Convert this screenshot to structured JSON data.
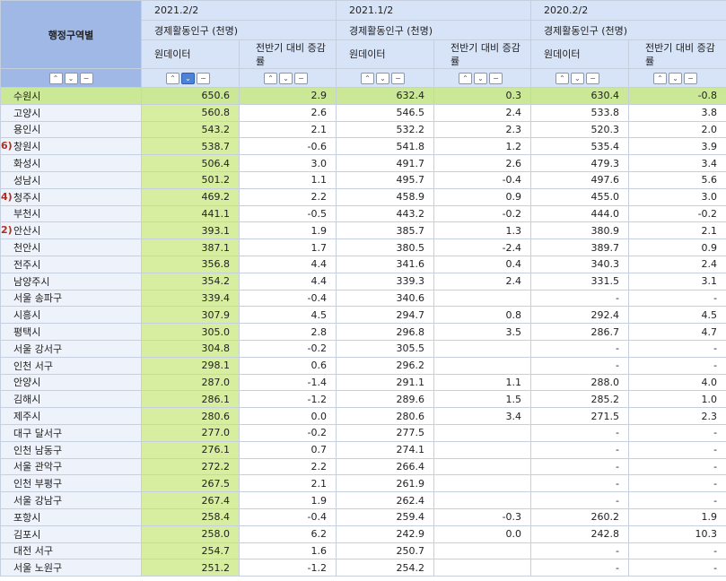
{
  "header": {
    "region_label": "행정구역별",
    "periods": [
      "2021.2/2",
      "2021.1/2",
      "2020.2/2"
    ],
    "indicator": "경제활동인구 (천명)",
    "col_raw": "원데이터",
    "col_rate": "전반기 대비 증감률"
  },
  "controls": {
    "up": "⌃",
    "down": "⌄",
    "minus": "−"
  },
  "rows": [
    {
      "name": "수원시",
      "a1": "650.6",
      "r1": "2.9",
      "a2": "632.4",
      "r2": "0.3",
      "a3": "630.4",
      "r3": "-0.8",
      "marker": ""
    },
    {
      "name": "고양시",
      "a1": "560.8",
      "r1": "2.6",
      "a2": "546.5",
      "r2": "2.4",
      "a3": "533.8",
      "r3": "3.8",
      "marker": ""
    },
    {
      "name": "용인시",
      "a1": "543.2",
      "r1": "2.1",
      "a2": "532.2",
      "r2": "2.3",
      "a3": "520.3",
      "r3": "2.0",
      "marker": ""
    },
    {
      "name": "창원시",
      "a1": "538.7",
      "r1": "-0.6",
      "a2": "541.8",
      "r2": "1.2",
      "a3": "535.4",
      "r3": "3.9",
      "marker": "6)"
    },
    {
      "name": "화성시",
      "a1": "506.4",
      "r1": "3.0",
      "a2": "491.7",
      "r2": "2.6",
      "a3": "479.3",
      "r3": "3.4",
      "marker": ""
    },
    {
      "name": "성남시",
      "a1": "501.2",
      "r1": "1.1",
      "a2": "495.7",
      "r2": "-0.4",
      "a3": "497.6",
      "r3": "5.6",
      "marker": ""
    },
    {
      "name": "청주시",
      "a1": "469.2",
      "r1": "2.2",
      "a2": "458.9",
      "r2": "0.9",
      "a3": "455.0",
      "r3": "3.0",
      "marker": "4)"
    },
    {
      "name": "부천시",
      "a1": "441.1",
      "r1": "-0.5",
      "a2": "443.2",
      "r2": "-0.2",
      "a3": "444.0",
      "r3": "-0.2",
      "marker": ""
    },
    {
      "name": "안산시",
      "a1": "393.1",
      "r1": "1.9",
      "a2": "385.7",
      "r2": "1.3",
      "a3": "380.9",
      "r3": "2.1",
      "marker": "2)"
    },
    {
      "name": "천안시",
      "a1": "387.1",
      "r1": "1.7",
      "a2": "380.5",
      "r2": "-2.4",
      "a3": "389.7",
      "r3": "0.9",
      "marker": ""
    },
    {
      "name": "전주시",
      "a1": "356.8",
      "r1": "4.4",
      "a2": "341.6",
      "r2": "0.4",
      "a3": "340.3",
      "r3": "2.4",
      "marker": ""
    },
    {
      "name": "남양주시",
      "a1": "354.2",
      "r1": "4.4",
      "a2": "339.3",
      "r2": "2.4",
      "a3": "331.5",
      "r3": "3.1",
      "marker": ""
    },
    {
      "name": "서울 송파구",
      "a1": "339.4",
      "r1": "-0.4",
      "a2": "340.6",
      "r2": "",
      "a3": "-",
      "r3": "-",
      "marker": ""
    },
    {
      "name": "시흥시",
      "a1": "307.9",
      "r1": "4.5",
      "a2": "294.7",
      "r2": "0.8",
      "a3": "292.4",
      "r3": "4.5",
      "marker": ""
    },
    {
      "name": "평택시",
      "a1": "305.0",
      "r1": "2.8",
      "a2": "296.8",
      "r2": "3.5",
      "a3": "286.7",
      "r3": "4.7",
      "marker": ""
    },
    {
      "name": "서울 강서구",
      "a1": "304.8",
      "r1": "-0.2",
      "a2": "305.5",
      "r2": "",
      "a3": "-",
      "r3": "-",
      "marker": ""
    },
    {
      "name": "인천 서구",
      "a1": "298.1",
      "r1": "0.6",
      "a2": "296.2",
      "r2": "",
      "a3": "-",
      "r3": "-",
      "marker": ""
    },
    {
      "name": "안양시",
      "a1": "287.0",
      "r1": "-1.4",
      "a2": "291.1",
      "r2": "1.1",
      "a3": "288.0",
      "r3": "4.0",
      "marker": ""
    },
    {
      "name": "김해시",
      "a1": "286.1",
      "r1": "-1.2",
      "a2": "289.6",
      "r2": "1.5",
      "a3": "285.2",
      "r3": "1.0",
      "marker": ""
    },
    {
      "name": "제주시",
      "a1": "280.6",
      "r1": "0.0",
      "a2": "280.6",
      "r2": "3.4",
      "a3": "271.5",
      "r3": "2.3",
      "marker": ""
    },
    {
      "name": "대구 달서구",
      "a1": "277.0",
      "r1": "-0.2",
      "a2": "277.5",
      "r2": "",
      "a3": "-",
      "r3": "-",
      "marker": ""
    },
    {
      "name": "인천 남동구",
      "a1": "276.1",
      "r1": "0.7",
      "a2": "274.1",
      "r2": "",
      "a3": "-",
      "r3": "-",
      "marker": ""
    },
    {
      "name": "서울 관악구",
      "a1": "272.2",
      "r1": "2.2",
      "a2": "266.4",
      "r2": "",
      "a3": "-",
      "r3": "-",
      "marker": ""
    },
    {
      "name": "인천 부평구",
      "a1": "267.5",
      "r1": "2.1",
      "a2": "261.9",
      "r2": "",
      "a3": "-",
      "r3": "-",
      "marker": ""
    },
    {
      "name": "서울 강남구",
      "a1": "267.4",
      "r1": "1.9",
      "a2": "262.4",
      "r2": "",
      "a3": "-",
      "r3": "-",
      "marker": ""
    },
    {
      "name": "포항시",
      "a1": "258.4",
      "r1": "-0.4",
      "a2": "259.4",
      "r2": "-0.3",
      "a3": "260.2",
      "r3": "1.9",
      "marker": ""
    },
    {
      "name": "김포시",
      "a1": "258.0",
      "r1": "6.2",
      "a2": "242.9",
      "r2": "0.0",
      "a3": "242.8",
      "r3": "10.3",
      "marker": ""
    },
    {
      "name": "대전 서구",
      "a1": "254.7",
      "r1": "1.6",
      "a2": "250.7",
      "r2": "",
      "a3": "-",
      "r3": "-",
      "marker": ""
    },
    {
      "name": "서울 노원구",
      "a1": "251.2",
      "r1": "-1.2",
      "a2": "254.2",
      "r2": "",
      "a3": "-",
      "r3": "-",
      "marker": ""
    }
  ]
}
